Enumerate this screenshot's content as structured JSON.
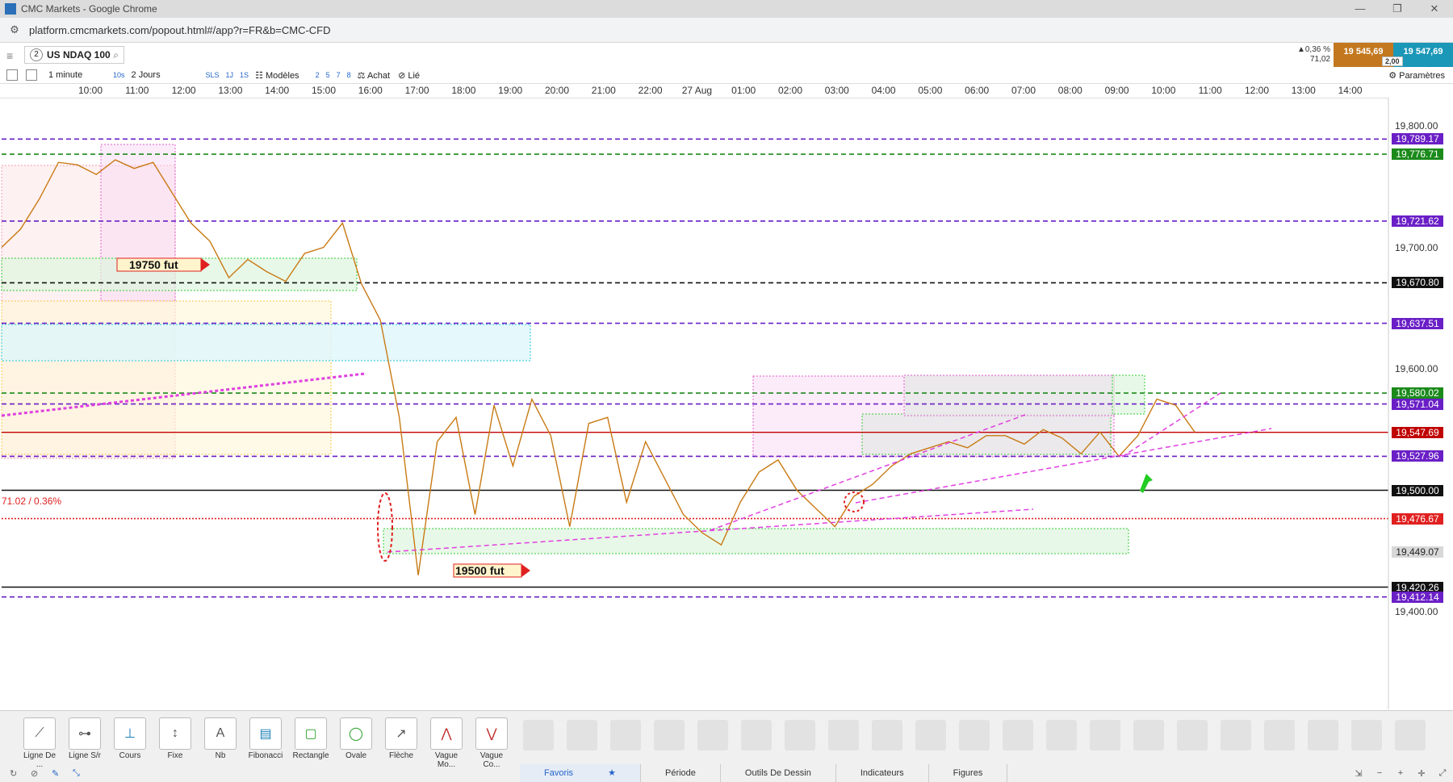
{
  "window": {
    "title": "CMC Markets - Google Chrome",
    "controls": [
      "—",
      "❐",
      "✕"
    ]
  },
  "browser": {
    "url": "platform.cmcmarkets.com/popout.html#/app?r=FR&b=CMC-CFD"
  },
  "instrument": {
    "count": "2",
    "name": "US NDAQ 100"
  },
  "quote": {
    "change_pct": "▲0,36 %",
    "change_pts": "71,02",
    "sell": "19 545,69",
    "buy": "19 547,69",
    "spread": "2,00"
  },
  "toolbar": {
    "interval": "1 minute",
    "timeframe_short": "10s",
    "range": "2 Jours",
    "quick": [
      "SLS",
      "1J",
      "1S"
    ],
    "templates": "Modèles",
    "numbers": [
      "2",
      "5",
      "7",
      "8"
    ],
    "buy": "Achat",
    "linked": "Lié",
    "settings": "Paramètres"
  },
  "time_axis": [
    "10:00",
    "11:00",
    "12:00",
    "13:00",
    "14:00",
    "15:00",
    "16:00",
    "17:00",
    "18:00",
    "19:00",
    "20:00",
    "21:00",
    "22:00",
    "27 Aug",
    "01:00",
    "02:00",
    "03:00",
    "04:00",
    "05:00",
    "06:00",
    "07:00",
    "08:00",
    "09:00",
    "10:00",
    "11:00",
    "12:00",
    "13:00",
    "14:00"
  ],
  "chart_data": {
    "type": "line",
    "title": "",
    "x_ticks": [
      "10:00",
      "11:00",
      "12:00",
      "13:00",
      "14:00",
      "15:00",
      "16:00",
      "17:00",
      "18:00",
      "19:00",
      "20:00",
      "21:00",
      "22:00",
      "27 Aug",
      "01:00",
      "02:00",
      "03:00",
      "04:00",
      "05:00",
      "06:00",
      "07:00",
      "08:00",
      "09:00",
      "10:00",
      "11:00",
      "12:00",
      "13:00",
      "14:00"
    ],
    "y_ticks": [
      "19,800.00",
      "19,700.00",
      "19,600.00",
      "19,500.00",
      "19,400.00"
    ],
    "ylim": [
      19380,
      19820
    ],
    "series": [
      {
        "values": [
          19700,
          19715,
          19740,
          19770,
          19768,
          19760,
          19772,
          19765,
          19770,
          19745,
          19720,
          19705,
          19675,
          19690,
          19680,
          19672,
          19695,
          19700,
          19720,
          19670,
          19640,
          19560,
          19430,
          19540,
          19560,
          19480,
          19570,
          19520,
          19575,
          19545,
          19470,
          19555,
          19560,
          19490,
          19540,
          19510,
          19480,
          19465,
          19455,
          19490,
          19515,
          19525,
          19500,
          19485,
          19470,
          19495,
          19505,
          19520,
          19530,
          19535,
          19540,
          19535,
          19545,
          19545,
          19538,
          19550,
          19543,
          19530,
          19548,
          19528,
          19545,
          19575,
          19570,
          19548
        ],
        "color": "#c87a14"
      }
    ],
    "levels": [
      {
        "value": "19,789.17",
        "color": "#6a1fc6",
        "style": "dashed"
      },
      {
        "value": "19,776.71",
        "color": "#1b8a1b",
        "style": "dashed"
      },
      {
        "value": "19,721.62",
        "color": "#6a1fc6",
        "style": "dashed"
      },
      {
        "value": "19,670.80",
        "color": "#111111",
        "style": "dashed"
      },
      {
        "value": "19,637.51",
        "color": "#6a1fc6",
        "style": "dashed"
      },
      {
        "value": "19,580.02",
        "color": "#1b8a1b",
        "style": "dashed"
      },
      {
        "value": "19,571.04",
        "color": "#6a1fc6",
        "style": "dashed"
      },
      {
        "value": "19,547.69",
        "color": "#c00000",
        "style": "solid"
      },
      {
        "value": "19,527.96",
        "color": "#6a1fc6",
        "style": "dashed"
      },
      {
        "value": "19,500.00",
        "color": "#111111",
        "style": "solid"
      },
      {
        "value": "19,476.67",
        "color": "#e02020",
        "style": "dotted"
      },
      {
        "value": "19,449.07",
        "color": "#d8d8d8",
        "style": "none"
      },
      {
        "value": "19,420.26",
        "color": "#111111",
        "style": "solid"
      },
      {
        "value": "19,412.14",
        "color": "#6a1fc6",
        "style": "dashed"
      }
    ],
    "annotations": [
      "19750 fut",
      "19500 fut",
      "71.02 / 0.36%"
    ]
  },
  "drawing_tools": [
    "Ligne De ...",
    "Ligne S/r",
    "Cours",
    "Fixe",
    "Nb",
    "Fibonacci",
    "Rectangle",
    "Ovale",
    "Flèche",
    "Vague Mo...",
    "Vague Co..."
  ],
  "bottom_tabs": [
    "Favoris",
    "Période",
    "Outils De Dessin",
    "Indicateurs",
    "Figures"
  ]
}
